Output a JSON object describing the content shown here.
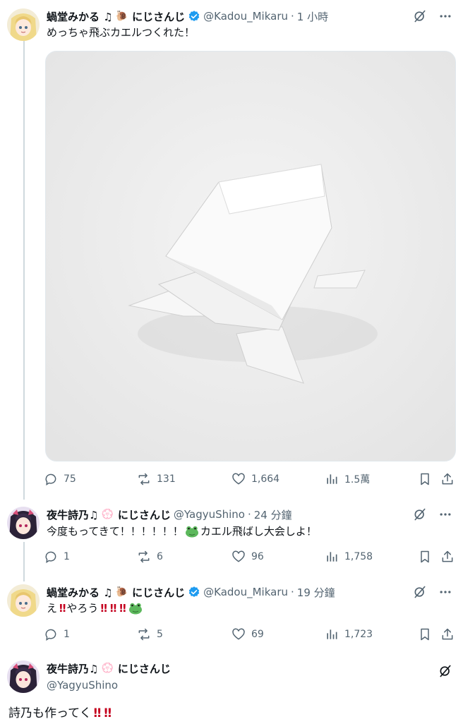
{
  "tweets": [
    {
      "name": "蝸堂みかる ♫",
      "name_emoji": "🐌",
      "affiliation": "にじさんじ",
      "verified": true,
      "handle": "@Kadou_Mikaru",
      "time": "1 小時",
      "text": "めっちゃ飛ぶカエルつくれた！",
      "stats": {
        "replies": "75",
        "retweets": "131",
        "likes": "1,664",
        "views": "1.5萬"
      }
    },
    {
      "name": "夜牛詩乃♫",
      "name_emoji": "💮",
      "affiliation": "にじさんじ",
      "verified": false,
      "handle": "@YagyuShino",
      "time": "24 分鐘",
      "text_parts": [
        "今度もってきて！！！！！！",
        "カエル飛ばし大会しよ！"
      ],
      "stats": {
        "replies": "1",
        "retweets": "6",
        "likes": "96",
        "views": "1,758"
      }
    },
    {
      "name": "蝸堂みかる ♫",
      "name_emoji": "🐌",
      "affiliation": "にじさんじ",
      "verified": true,
      "handle": "@Kadou_Mikaru",
      "time": "19 分鐘",
      "text_parts": [
        "え",
        "‼",
        "やろう",
        "‼",
        "‼",
        "‼"
      ],
      "stats": {
        "replies": "1",
        "retweets": "5",
        "likes": "69",
        "views": "1,723"
      }
    },
    {
      "name": "夜牛詩乃♫",
      "name_emoji": "💮",
      "affiliation": "にじさんじ",
      "verified": false,
      "handle": "@YagyuShino",
      "text_parts": [
        "詩乃も作ってく",
        "‼",
        "‼"
      ]
    }
  ],
  "icons": {
    "reply": "reply-icon",
    "retweet": "retweet-icon",
    "like": "heart-icon",
    "views": "views-chart-icon",
    "bookmark": "bookmark-icon",
    "share": "share-icon",
    "grok": "grok-icon",
    "more": "more-dots-icon",
    "verified": "verified-badge-icon"
  },
  "colors": {
    "verified": "#1d9bf0",
    "muted": "#536471",
    "text": "#0f1419",
    "bang": "#c4001e",
    "thread_line": "#cfd9de"
  }
}
